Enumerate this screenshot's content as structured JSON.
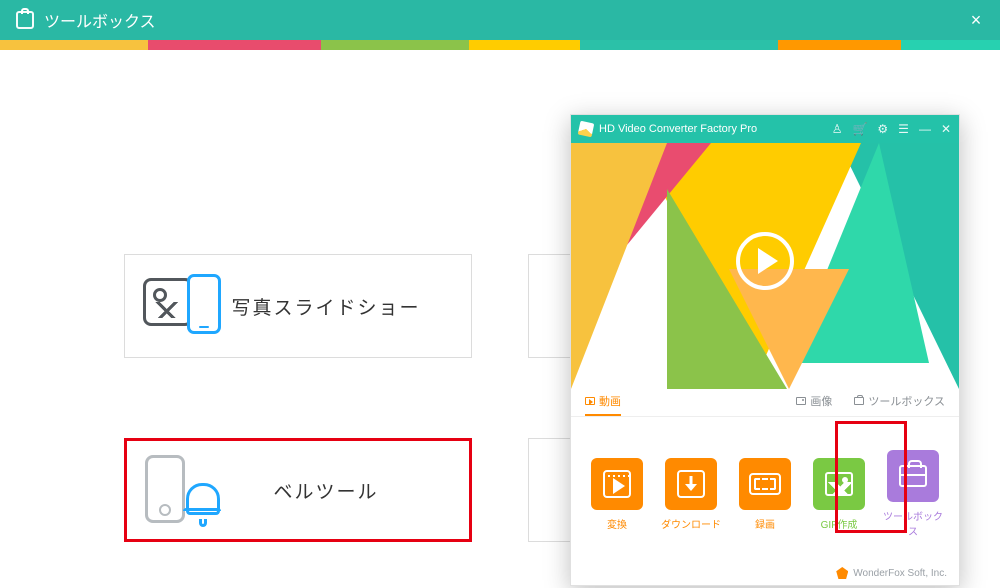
{
  "topbar": {
    "title": "ツールボックス"
  },
  "cards": {
    "slideshow": "写真スライドショー",
    "belltool": "ベルツール"
  },
  "product": {
    "title": "HD Video Converter Factory Pro",
    "tabs": {
      "video": "動画",
      "image": "画像",
      "toolbox": "ツールボックス"
    },
    "tiles": {
      "convert": "変換",
      "download": "ダウンロード",
      "record": "録画",
      "gif": "GIF作成",
      "toolbox": "ツールボックス"
    },
    "footer": "WonderFox Soft, Inc."
  }
}
